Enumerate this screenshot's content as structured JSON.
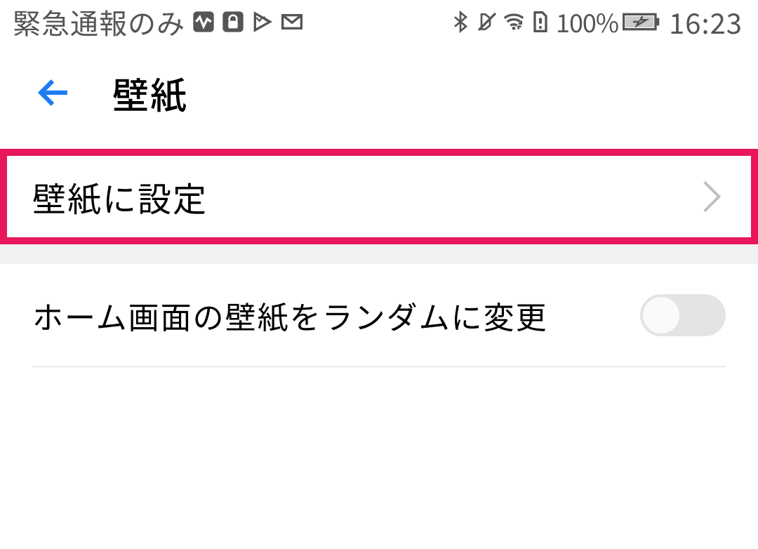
{
  "status_bar": {
    "carrier_text": "緊急通報のみ",
    "battery_pct": "100%",
    "clock": "16:23"
  },
  "header": {
    "title": "壁紙"
  },
  "rows": {
    "set_wallpaper": {
      "label": "壁紙に設定"
    },
    "random_wallpaper": {
      "label": "ホーム画面の壁紙をランダムに変更",
      "toggle_on": false
    }
  }
}
